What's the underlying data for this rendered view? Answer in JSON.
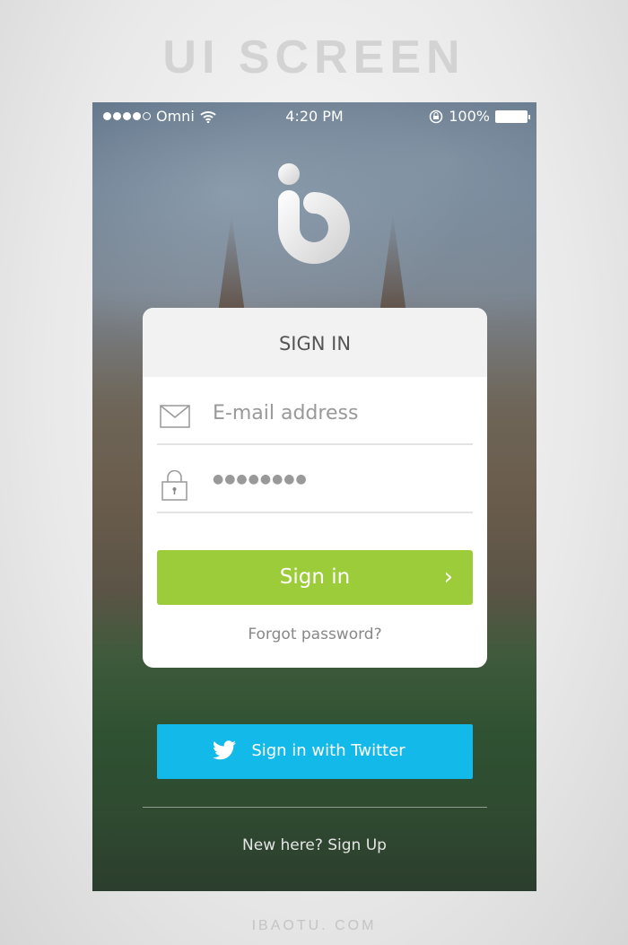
{
  "banner": {
    "title": "UI SCREEN",
    "footer": "IBAOTU. COM"
  },
  "status_bar": {
    "carrier": "Omni",
    "time": "4:20 PM",
    "battery": "100%",
    "signal_bars": 4,
    "signal_max": 5
  },
  "card": {
    "title": "SIGN IN",
    "email_placeholder": "E-mail address",
    "password_mask": "●●●●●●●●",
    "sign_in_label": "Sign in",
    "forgot_label": "Forgot password?"
  },
  "twitter": {
    "label": "Sign in with Twitter"
  },
  "signup": {
    "label": "New here? Sign Up"
  },
  "colors": {
    "accent_green": "#9ccc3a",
    "twitter_blue": "#13b9e8"
  },
  "icons": [
    "wifi-icon",
    "rotation-lock-icon",
    "battery-icon",
    "mail-icon",
    "lock-icon",
    "chevron-right-icon",
    "twitter-bird-icon"
  ]
}
